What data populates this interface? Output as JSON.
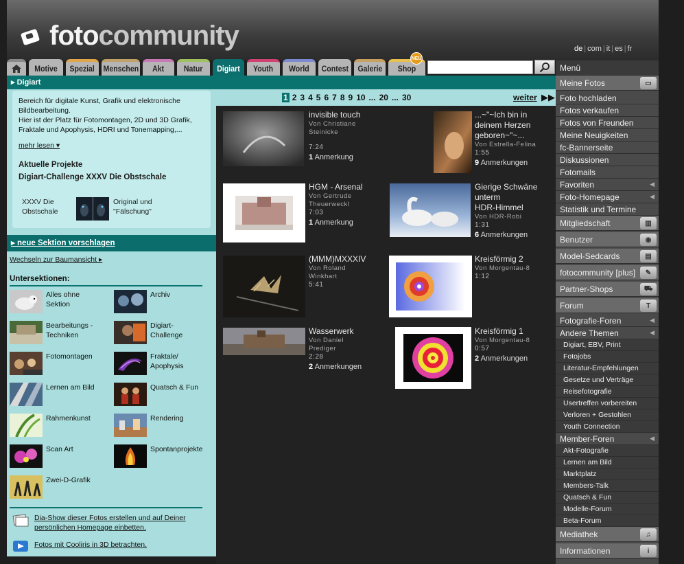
{
  "header": {
    "logo_text_a": "foto",
    "logo_text_b": "community",
    "languages": [
      "de",
      "com",
      "it",
      "es",
      "fr"
    ]
  },
  "tabs": [
    "Motive",
    "Spezial",
    "Menschen",
    "Akt",
    "Natur",
    "Digiart",
    "Youth",
    "World",
    "Contest",
    "Galerie",
    "Shop"
  ],
  "tab_colors": [
    "#b5b5b5",
    "#e0a64a",
    "#c0a16a",
    "#c77ab5",
    "#a0c060",
    "#0d6f6d",
    "#d04070",
    "#7c8ad0",
    "#b5b5b5",
    "#c8a060",
    "#e8c050"
  ],
  "shop_badge": "NEU",
  "search": {
    "value": "",
    "placeholder": ""
  },
  "section": {
    "title": "Digiart"
  },
  "intro": {
    "text": "Bereich für digitale Kunst, Grafik und elektronische Bildbearbeitung.\nHier ist der Platz für Fotomontagen, 2D und 3D Grafik, Fraktale und Apophysis, HDRI und Tonemapping,...",
    "more": "mehr lesen ▾",
    "projects_heading": "Aktuelle Projekte",
    "project_name": "Digiart-Challenge XXXV Die Obstschale",
    "project_items": [
      "XXXV Die\nObstschale",
      "Original und\n\"Fälschung\""
    ]
  },
  "suggest": "▸ neue Sektion vorschlagen",
  "tree_view": "Wechseln zur Baumansicht ▸",
  "subsections_heading": "Untersektionen:",
  "subsections": [
    "Alles ohne\nSektion",
    "Archiv",
    "Bearbeitungs -\nTechniken",
    "Digiart-\nChallenge",
    "Fotomontagen",
    "Fraktale/\nApophysis",
    "Lernen am Bild",
    "Quatsch & Fun",
    "Rahmenkunst",
    "Rendering",
    "Scan Art",
    "Spontanprojekte",
    "Zwei-D-Grafik"
  ],
  "footer_links": [
    "Dia-Show dieser Fotos erstellen und auf Deiner\npersönlichen Homepage einbetten.",
    "Fotos mit Cooliris in 3D betrachten."
  ],
  "pager": {
    "pages": [
      "1",
      "2",
      "3",
      "4",
      "5",
      "6",
      "7",
      "8",
      "9",
      "10",
      "...",
      "20",
      "...",
      "30"
    ],
    "current": "1",
    "next": "weiter"
  },
  "photos": [
    {
      "title": "invisible touch",
      "by": "Von Christiane\nSteinicke",
      "time": "7:24",
      "count": "1",
      "count_label": " Anmerkung"
    },
    {
      "title": "...~\"~Ich bin in\ndeinem Herzen\ngeboren~\"~...",
      "by": "Von Estrella-Felina",
      "time": "1:55",
      "count": "9",
      "count_label": " Anmerkungen"
    },
    {
      "title": "HGM - Arsenal",
      "by": "Von Gertrude\nTheuerweckl",
      "time": "7:03",
      "count": "1",
      "count_label": " Anmerkung"
    },
    {
      "title": "Gierige Schwäne\nunterm\nHDR-Himmel",
      "by": "Von HDR-Robi",
      "time": "1:31",
      "count": "6",
      "count_label": " Anmerkungen"
    },
    {
      "title": "(MMM)MXXXIV",
      "by": "Von Roland\nWinkhart",
      "time": "5:41",
      "count": "",
      "count_label": ""
    },
    {
      "title": "Kreisförmig 2",
      "by": "Von Morgentau-8",
      "time": "1:12",
      "count": "",
      "count_label": ""
    },
    {
      "title": "Wasserwerk",
      "by": "Von Daniel\nPrediger",
      "time": "2:28",
      "count": "2",
      "count_label": " Anmerkungen"
    },
    {
      "title": "Kreisförmig 1",
      "by": "Von Morgentau-8",
      "time": "0:57",
      "count": "2",
      "count_label": " Anmerkungen"
    }
  ],
  "menu": {
    "title": "Menü",
    "items": [
      {
        "label": "Meine Fotos",
        "kind": "hdr",
        "icon": "photos-icon"
      },
      {
        "label": "Foto hochladen",
        "kind": "norm"
      },
      {
        "label": "Fotos verkaufen",
        "kind": "norm"
      },
      {
        "label": "Fotos von Freunden",
        "kind": "norm"
      },
      {
        "label": "Meine Neuigkeiten",
        "kind": "norm"
      },
      {
        "label": "fc-Bannerseite",
        "kind": "norm"
      },
      {
        "label": "Diskussionen",
        "kind": "norm"
      },
      {
        "label": "Fotomails",
        "kind": "norm"
      },
      {
        "label": "Favoriten",
        "kind": "norm",
        "arrow": true
      },
      {
        "label": "Foto-Homepage",
        "kind": "norm",
        "arrow": true
      },
      {
        "label": "Statistik und Termine",
        "kind": "norm"
      },
      {
        "label": "Mitgliedschaft",
        "kind": "hdr",
        "icon": "membership-icon"
      },
      {
        "label": "Benutzer",
        "kind": "hdr",
        "icon": "users-icon"
      },
      {
        "label": "Model-Sedcards",
        "kind": "hdr",
        "icon": "sedcard-icon"
      },
      {
        "label": "fotocommunity [plus]",
        "kind": "hdr",
        "icon": "plus-icon"
      },
      {
        "label": "Partner-Shops",
        "kind": "hdr",
        "icon": "cart-icon"
      },
      {
        "label": "Forum",
        "kind": "hdr",
        "icon": "forum-icon"
      },
      {
        "label": "Fotografie-Foren",
        "kind": "norm",
        "arrow": true
      },
      {
        "label": "Andere Themen",
        "kind": "norm",
        "arrow": true
      },
      {
        "label": "Digiart, EBV, Print",
        "kind": "sub2"
      },
      {
        "label": "Fotojobs",
        "kind": "sub2"
      },
      {
        "label": "Literatur-Empfehlungen",
        "kind": "sub2"
      },
      {
        "label": "Gesetze und Verträge",
        "kind": "sub2"
      },
      {
        "label": "Reisefotografie",
        "kind": "sub2"
      },
      {
        "label": "Usertreffen vorbereiten",
        "kind": "sub2"
      },
      {
        "label": "Verloren + Gestohlen",
        "kind": "sub2"
      },
      {
        "label": "Youth Connection",
        "kind": "sub2"
      },
      {
        "label": "Member-Foren",
        "kind": "norm",
        "arrow": true
      },
      {
        "label": "Akt-Fotografie",
        "kind": "sub2"
      },
      {
        "label": "Lernen am Bild",
        "kind": "sub2"
      },
      {
        "label": "Marktplatz",
        "kind": "sub2"
      },
      {
        "label": "Members-Talk",
        "kind": "sub2"
      },
      {
        "label": "Quatsch & Fun",
        "kind": "sub2"
      },
      {
        "label": "Modelle-Forum",
        "kind": "sub2"
      },
      {
        "label": "Beta-Forum",
        "kind": "sub2"
      },
      {
        "label": "Mediathek",
        "kind": "hdr",
        "icon": "media-icon"
      },
      {
        "label": "Informationen",
        "kind": "hdr",
        "icon": "info-icon"
      }
    ]
  }
}
